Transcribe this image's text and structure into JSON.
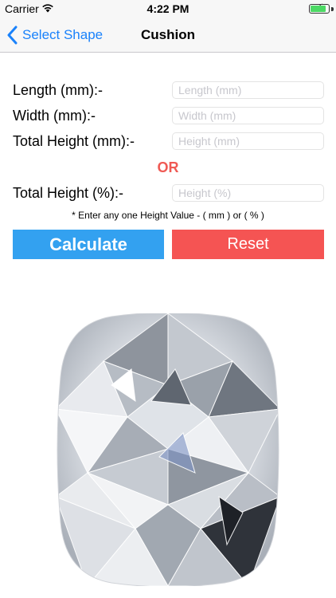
{
  "status_bar": {
    "carrier": "Carrier",
    "time": "4:22 PM",
    "battery_level": 0.85,
    "icons": [
      "wifi-icon",
      "charging-icon",
      "battery-icon"
    ]
  },
  "nav": {
    "back_label": "Select Shape",
    "title": "Cushion"
  },
  "form": {
    "length_label": "Length (mm):-",
    "length_placeholder": "Length (mm)",
    "width_label": "Width (mm):-",
    "width_placeholder": "Width (mm)",
    "total_height_label": "Total Height (mm):-",
    "total_height_placeholder": "Height (mm)",
    "or_text": "OR",
    "total_height_pct_label": "Total Height (%):-",
    "total_height_pct_placeholder": "Height (%)",
    "hint": "* Enter any one Height Value - ( mm ) or ( % )"
  },
  "buttons": {
    "calculate": "Calculate",
    "reset": "Reset"
  },
  "colors": {
    "accent_blue": "#1a82fb",
    "calculate_bg": "#33a1f0",
    "reset_bg": "#f55453",
    "or_color": "#ef5a54"
  }
}
